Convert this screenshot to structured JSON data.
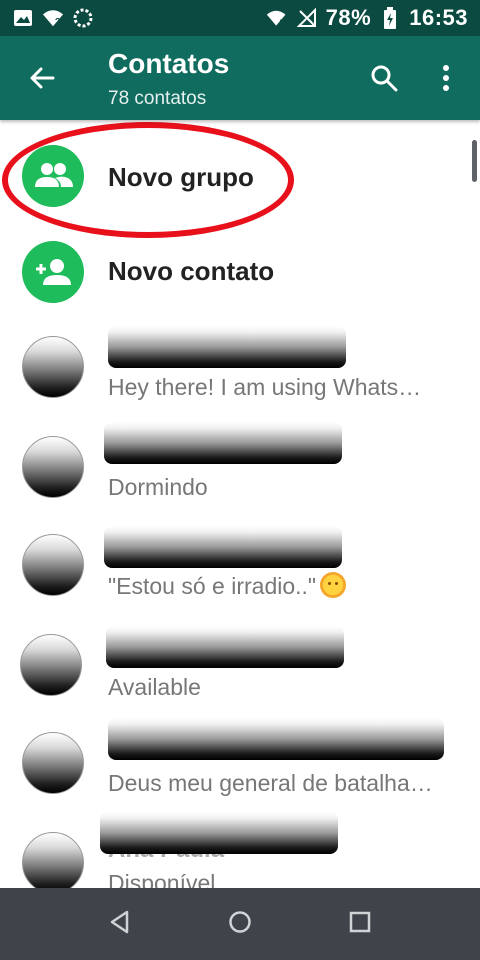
{
  "status_bar": {
    "battery": "78%",
    "time": "16:53",
    "icons_left": [
      "image-icon",
      "wifi-question-icon",
      "sync-icon"
    ],
    "icons_right": [
      "wifi-x-icon",
      "no-signal-icon",
      "battery-icon"
    ]
  },
  "app_bar": {
    "title": "Contatos",
    "subtitle": "78 contatos",
    "icons": [
      "back-arrow-icon",
      "search-icon",
      "more-vert-icon"
    ]
  },
  "actions": [
    {
      "label": "Novo grupo",
      "icon": "group-icon"
    },
    {
      "label": "Novo contato",
      "icon": "add-contact-icon"
    }
  ],
  "contacts": [
    {
      "status": "Hey there! I am using Whats…"
    },
    {
      "status": "Dormindo"
    },
    {
      "status": "\"Estou só e irradio..\"",
      "emoji": "sun-face-icon"
    },
    {
      "status": "Available"
    },
    {
      "status": "Deus meu general de batalha…"
    },
    {
      "name_fragment": "Ana Paula",
      "status": "Disponível"
    }
  ],
  "colors": {
    "status_bar": "#0a4a40",
    "app_bar": "#0f6c5e",
    "accent_green": "#1ebc5a",
    "highlight": "#e8101a",
    "nav_bar": "#3e444a"
  },
  "nav": [
    "back-triangle-icon",
    "home-circle-icon",
    "recents-square-icon"
  ]
}
